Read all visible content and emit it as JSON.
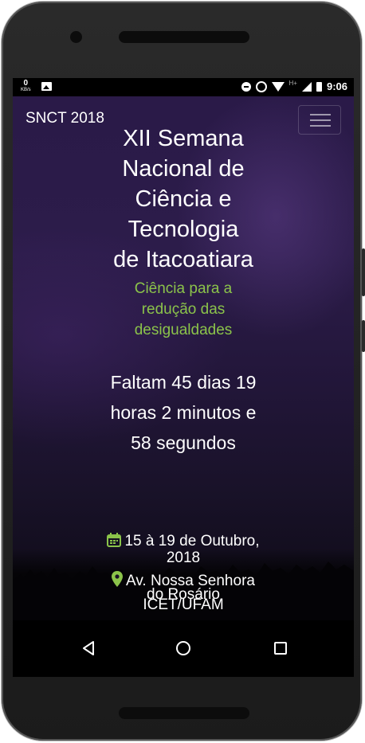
{
  "statusbar": {
    "kbs_value": "0",
    "kbs_unit": "KB/s",
    "network_type": "H+",
    "time": "9:06"
  },
  "app": {
    "brand": "SNCT 2018",
    "title_lines": [
      "XII Semana",
      "Nacional de",
      "Ciência e",
      "Tecnologia",
      "de Itacoatiara"
    ],
    "subtitle_lines": [
      "Ciência para a",
      "redução das",
      "desigualdades"
    ],
    "countdown_lines": [
      "Faltam 45 dias 19",
      "horas 2 minutos e",
      "58 segundos"
    ],
    "date_lines": [
      "15 à 19 de Outubro,",
      "2018"
    ],
    "location_lines": [
      "Av. Nossa Senhora",
      "do Rosário",
      "ICET/UFAM"
    ]
  },
  "colors": {
    "accent": "#8bc34a",
    "background_top": "#2a1a48",
    "text": "#ffffff"
  },
  "icons": {
    "date": "calendar-icon",
    "location": "map-marker-icon",
    "nav_back": "triangle-back-icon",
    "nav_home": "circle-home-icon",
    "nav_recent": "square-recent-icon"
  }
}
